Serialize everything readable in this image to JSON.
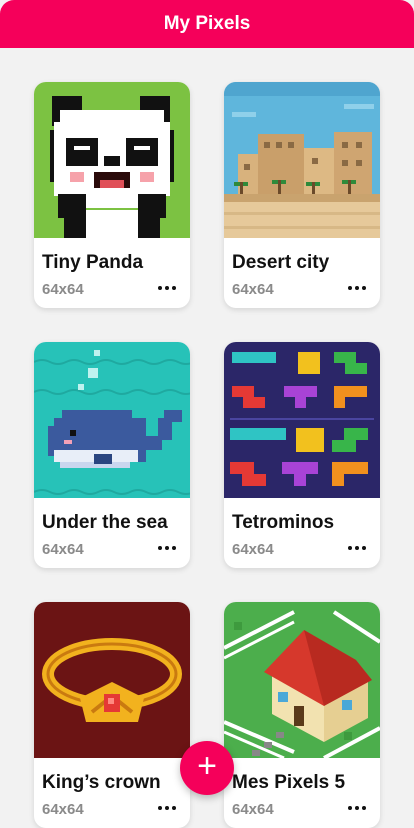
{
  "app": {
    "title": "My Pixels"
  },
  "cards": [
    {
      "title": "Tiny Panda",
      "size": "64x64",
      "thumb": "panda"
    },
    {
      "title": "Desert city",
      "size": "64x64",
      "thumb": "desert"
    },
    {
      "title": "Under the sea",
      "size": "64x64",
      "thumb": "whale"
    },
    {
      "title": "Tetrominos",
      "size": "64x64",
      "thumb": "tetris"
    },
    {
      "title": "King’s crown",
      "size": "64x64",
      "thumb": "crown"
    },
    {
      "title": "Mes Pixels 5",
      "size": "64x64",
      "thumb": "house"
    }
  ],
  "fab": {
    "icon": "plus-icon",
    "label": "+"
  },
  "colors": {
    "accent": "#f5005a",
    "background": "#f2f2f2"
  }
}
